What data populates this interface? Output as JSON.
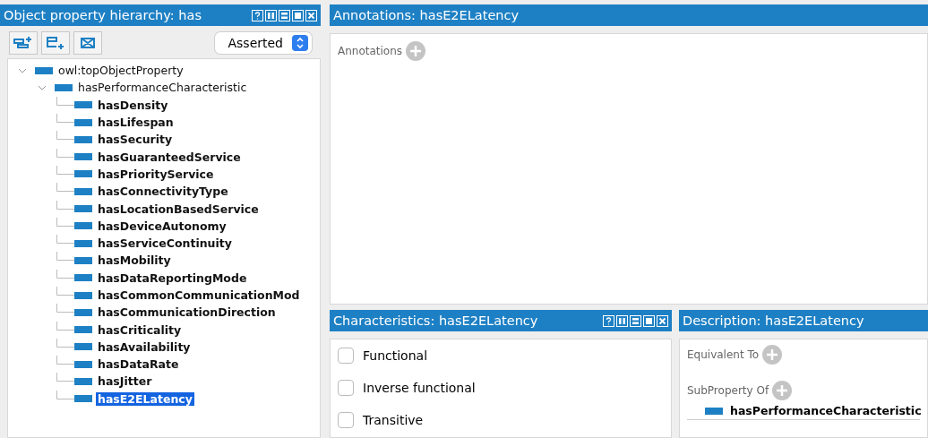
{
  "hierarchy": {
    "title": "Object property hierarchy: has",
    "toolbar": {
      "mode": "Asserted"
    },
    "tree": [
      {
        "label": "owl:topObjectProperty",
        "selected": false,
        "expanded": true,
        "children": [
          {
            "label": "hasPerformanceCharacteristic",
            "selected": false,
            "expanded": true,
            "children": [
              {
                "label": "hasDensity",
                "selected": false
              },
              {
                "label": "hasLifespan",
                "selected": false
              },
              {
                "label": "hasSecurity",
                "selected": false
              },
              {
                "label": "hasGuaranteedService",
                "selected": false
              },
              {
                "label": "hasPriorityService",
                "selected": false
              },
              {
                "label": "hasConnectivityType",
                "selected": false
              },
              {
                "label": "hasLocationBasedService",
                "selected": false
              },
              {
                "label": "hasDeviceAutonomy",
                "selected": false
              },
              {
                "label": "hasServiceContinuity",
                "selected": false
              },
              {
                "label": "hasMobility",
                "selected": false
              },
              {
                "label": "hasDataReportingMode",
                "selected": false
              },
              {
                "label": "hasCommonCommunicationMod",
                "selected": false
              },
              {
                "label": "hasCommunicationDirection",
                "selected": false
              },
              {
                "label": "hasCriticality",
                "selected": false
              },
              {
                "label": "hasAvailability",
                "selected": false
              },
              {
                "label": "hasDataRate",
                "selected": false
              },
              {
                "label": "hasJitter",
                "selected": false
              },
              {
                "label": "hasE2ELatency",
                "selected": true
              }
            ]
          }
        ]
      }
    ]
  },
  "annotations": {
    "title": "Annotations: hasE2ELatency",
    "section": "Annotations"
  },
  "characteristics": {
    "title": "Characteristics: hasE2ELatency",
    "items": [
      {
        "label": "Functional",
        "checked": false
      },
      {
        "label": "Inverse functional",
        "checked": false
      },
      {
        "label": "Transitive",
        "checked": false
      }
    ]
  },
  "description": {
    "title": "Description: hasE2ELatency",
    "sections": [
      {
        "label": "Equivalent To"
      },
      {
        "label": "SubProperty Of",
        "items": [
          "hasPerformanceCharacteristic"
        ]
      }
    ]
  }
}
